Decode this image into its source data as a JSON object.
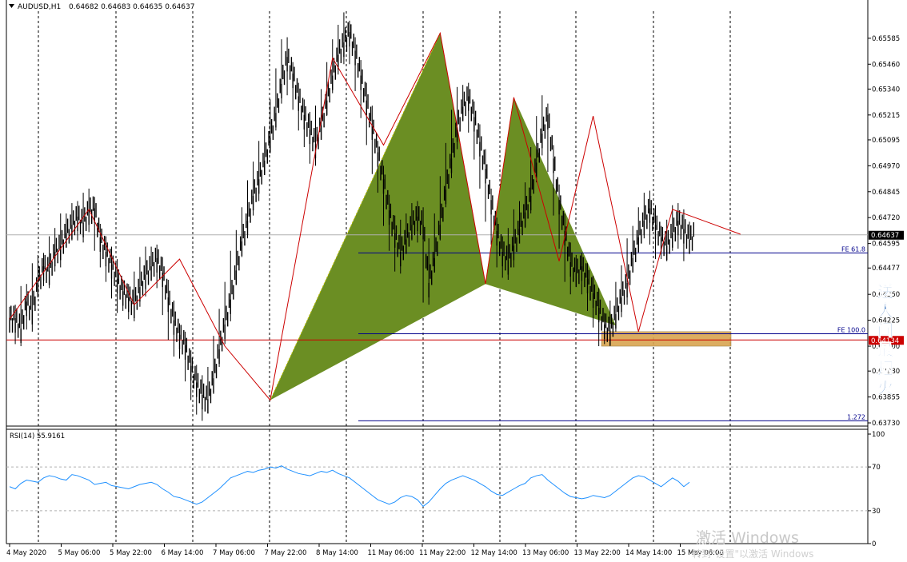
{
  "header": {
    "symbol": "AUDUSD,H1",
    "ohlc": "0.64682 0.64683 0.64635 0.64637"
  },
  "chart_data": [
    {
      "type": "line",
      "title": "AUDUSD,H1",
      "ylim": [
        0.6373,
        0.6565
      ],
      "y_ticks": [
        "0.65585",
        "0.65460",
        "0.65340",
        "0.65215",
        "0.65095",
        "0.64970",
        "0.64845",
        "0.64720",
        "0.64595",
        "0.64477",
        "0.64350",
        "0.64225",
        "0.64100",
        "0.63980",
        "0.63855",
        "0.63730"
      ],
      "x_ticks": [
        "4 May 2020",
        "5 May 06:00",
        "5 May 22:00",
        "6 May 14:00",
        "7 May 06:00",
        "7 May 22:00",
        "8 May 14:00",
        "11 May 06:00",
        "11 May 22:00",
        "12 May 14:00",
        "13 May 06:00",
        "13 May 22:00",
        "14 May 14:00",
        "15 May 06:00"
      ],
      "last_price": "0.64637",
      "current_marker": "0.64134",
      "levels": [
        {
          "label": "FE 61.8",
          "price": 0.6455,
          "color": "#00008b"
        },
        {
          "label": "FE 100.0",
          "price": 0.6416,
          "color": "#00008b"
        },
        {
          "label": "1.272",
          "price": 0.6374,
          "color": "#00008b"
        },
        {
          "label": "",
          "price": 0.6413,
          "color": "#cc0000"
        }
      ],
      "zigzag": {
        "color": "#cc0000",
        "x": [
          0,
          14,
          22,
          30,
          38,
          46,
          57,
          66,
          76,
          84,
          89,
          97,
          103,
          111,
          117,
          129
        ],
        "y": [
          0.6423,
          0.6476,
          0.643,
          0.6452,
          0.641,
          0.6384,
          0.6549,
          0.6507,
          0.6561,
          0.644,
          0.653,
          0.6451,
          0.6521,
          0.6417,
          0.6476,
          0.6464
        ]
      },
      "pattern": {
        "color": "#6b8e23",
        "points_x": [
          46,
          66,
          76,
          84,
          89,
          107
        ],
        "points_y": [
          0.6384,
          0.6507,
          0.6561,
          0.644,
          0.653,
          0.642
        ]
      },
      "target_zone": {
        "y_from": 0.641,
        "y_to": 0.6417,
        "fill": "#d9a550"
      },
      "series": [
        {
          "name": "AUDUSD",
          "color": "#000000",
          "values": [
            0.6423,
            0.6418,
            0.6431,
            0.6427,
            0.644,
            0.6448,
            0.6446,
            0.6455,
            0.6458,
            0.6464,
            0.6468,
            0.6472,
            0.6469,
            0.6475,
            0.6476,
            0.6462,
            0.6455,
            0.6449,
            0.6442,
            0.6436,
            0.6433,
            0.643,
            0.6438,
            0.6444,
            0.6448,
            0.6452,
            0.6445,
            0.6433,
            0.6422,
            0.6415,
            0.641,
            0.64,
            0.6392,
            0.6386,
            0.6384,
            0.6394,
            0.6408,
            0.642,
            0.6432,
            0.6446,
            0.646,
            0.647,
            0.6482,
            0.649,
            0.6499,
            0.651,
            0.6522,
            0.6536,
            0.6549,
            0.6541,
            0.653,
            0.6521,
            0.6514,
            0.6507,
            0.6516,
            0.6528,
            0.654,
            0.655,
            0.6556,
            0.6561,
            0.6552,
            0.654,
            0.6528,
            0.6516,
            0.6503,
            0.649,
            0.6475,
            0.6464,
            0.6455,
            0.6461,
            0.6468,
            0.6472,
            0.6468,
            0.644,
            0.6452,
            0.6468,
            0.6485,
            0.65,
            0.6515,
            0.6525,
            0.653,
            0.652,
            0.6508,
            0.6495,
            0.648,
            0.6465,
            0.6455,
            0.6451,
            0.6458,
            0.6466,
            0.6474,
            0.6482,
            0.6498,
            0.6512,
            0.6521,
            0.65,
            0.648,
            0.6465,
            0.645,
            0.6445,
            0.6448,
            0.6442,
            0.6435,
            0.6428,
            0.642,
            0.6417,
            0.6425,
            0.6433,
            0.644,
            0.6452,
            0.6462,
            0.647,
            0.6476,
            0.6468,
            0.6462,
            0.6458,
            0.6464,
            0.647,
            0.6466,
            0.6461,
            0.6464
          ]
        }
      ]
    },
    {
      "type": "line",
      "title": "RSI(14) 55.9161",
      "ylim": [
        0,
        100
      ],
      "y_ticks": [
        "100",
        "70",
        "30",
        "0"
      ],
      "levels": [
        70,
        30
      ],
      "series": [
        {
          "name": "RSI(14)",
          "color": "#1e90ff",
          "values": [
            52,
            50,
            55,
            58,
            57,
            56,
            60,
            62,
            61,
            59,
            58,
            63,
            62,
            60,
            58,
            54,
            55,
            56,
            53,
            52,
            51,
            50,
            52,
            54,
            55,
            56,
            54,
            50,
            47,
            43,
            42,
            40,
            38,
            36,
            38,
            42,
            46,
            50,
            55,
            60,
            62,
            64,
            66,
            65,
            67,
            68,
            70,
            69,
            71,
            68,
            66,
            64,
            63,
            62,
            64,
            66,
            65,
            67,
            64,
            62,
            60,
            56,
            52,
            48,
            44,
            40,
            38,
            36,
            38,
            42,
            44,
            43,
            40,
            34,
            38,
            44,
            50,
            55,
            58,
            60,
            62,
            60,
            58,
            55,
            52,
            48,
            45,
            44,
            47,
            50,
            53,
            55,
            60,
            62,
            63,
            58,
            54,
            50,
            46,
            43,
            42,
            41,
            42,
            44,
            43,
            42,
            44,
            48,
            52,
            56,
            60,
            62,
            61,
            58,
            55,
            52,
            56,
            60,
            57,
            52,
            56
          ]
        }
      ]
    }
  ],
  "watermark": {
    "line1": "激活 Windows",
    "line2": "转到\"设置\"以激活 Windows"
  },
  "overlay_text": [
    "送",
    "人",
    "间",
    "最",
    "烟",
    "火"
  ]
}
